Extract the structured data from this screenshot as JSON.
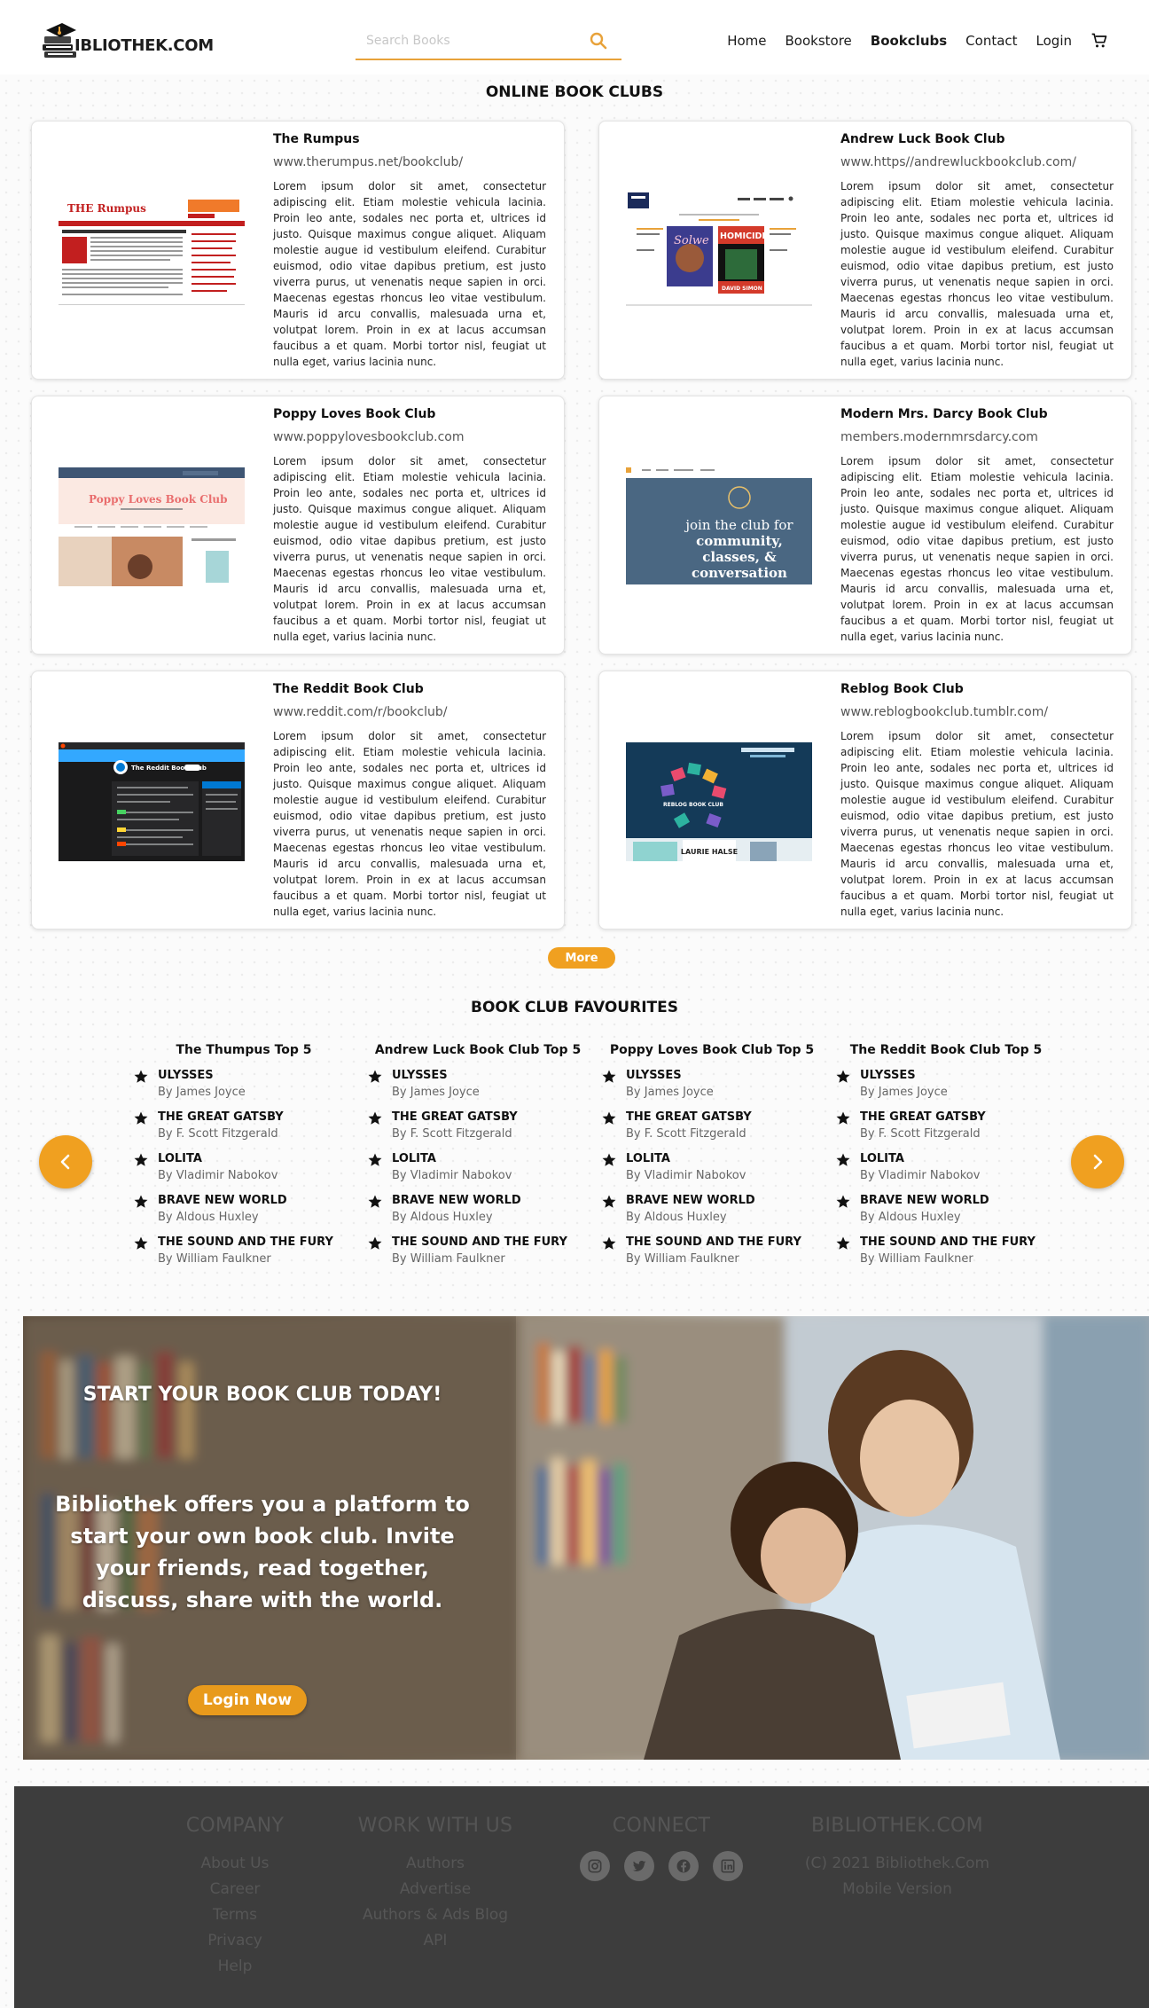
{
  "header": {
    "logo_text": "IBLIOTHEK.COM",
    "search_placeholder": "Search Books",
    "nav": [
      "Home",
      "Bookstore",
      "Bookclubs",
      "Contact",
      "Login"
    ],
    "active_nav": "Bookclubs"
  },
  "clubs": {
    "title": "ONLINE BOOK CLUBS",
    "description": "Lorem ipsum dolor sit amet, consectetur adipiscing elit. Etiam molestie vehicula lacinia. Proin leo ante, sodales nec porta et, ultrices id justo. Quisque maximus congue aliquet. Aliquam molestie augue id vestibulum eleifend. Curabitur euismod, odio vitae dapibus pretium, est justo viverra purus, ut venenatis neque sapien in orci. Maecenas egestas rhoncus leo vitae vestibulum. Mauris id arcu convallis, malesuada urna et, volutpat lorem. Proin in ex at lacus accumsan faucibus a et quam. Morbi tortor nisl, feugiat ut nulla eget, varius lacinia nunc.",
    "items": [
      {
        "name": "The Rumpus",
        "url": "www.therumpus.net/bookclub/"
      },
      {
        "name": "Andrew Luck Book Club",
        "url": "www.https//andrewluckbookclub.com/"
      },
      {
        "name": "Poppy Loves Book Club",
        "url": "www.poppylovesbookclub.com"
      },
      {
        "name": "Modern Mrs. Darcy Book Club",
        "url": "members.modernmrsdarcy.com"
      },
      {
        "name": "The Reddit Book Club",
        "url": "www.reddit.com/r/bookclub/"
      },
      {
        "name": "Reblog Book Club",
        "url": "www.reblogbookclub.tumblr.com/"
      }
    ],
    "thumb_texts": {
      "rumpus": "THE Rumpus",
      "poppy": "Poppy Loves Book Club",
      "darcy": "join the club for community, classes, & conversation",
      "reddit": "The Reddit Book Club",
      "andrew_book1": "Solwe",
      "andrew_book2": "HOMICIDE",
      "andrew_author": "DAVID SIMON",
      "reblog": "REBLOG BOOK CLUB",
      "reblog_author": "LAURIE HALSE"
    },
    "more_label": "More"
  },
  "favourites": {
    "title": "BOOK CLUB FAVOURITES",
    "columns": [
      {
        "title": "The Thumpus Top 5"
      },
      {
        "title": "Andrew Luck Book Club Top 5"
      },
      {
        "title": "Poppy Loves Book Club Top 5"
      },
      {
        "title": "The Reddit Book Club Top 5"
      }
    ],
    "books": [
      {
        "title": "ULYSSES",
        "author": "By James Joyce"
      },
      {
        "title": "THE GREAT GATSBY",
        "author": "By F. Scott Fitzgerald"
      },
      {
        "title": "LOLITA",
        "author": "By Vladimir Nabokov"
      },
      {
        "title": "BRAVE NEW WORLD",
        "author": "By Aldous Huxley"
      },
      {
        "title": "THE SOUND AND THE FURY",
        "author": "By William Faulkner"
      }
    ]
  },
  "hero": {
    "title": "START YOUR BOOK CLUB TODAY!",
    "text": "Bibliothek offers you a platform to start your own book club.  Invite your friends, read together, discuss, share with the world.",
    "button": "Login Now"
  },
  "footer": {
    "company": {
      "heading": "COMPANY",
      "links": [
        "About Us",
        "Career",
        "Terms",
        "Privacy",
        "Help"
      ]
    },
    "work": {
      "heading": "WORK WITH US",
      "links": [
        "Authors",
        "Advertise",
        "Authors & Ads Blog",
        "API"
      ]
    },
    "connect": {
      "heading": "CONNECT",
      "icons": [
        "instagram-icon",
        "twitter-icon",
        "facebook-icon",
        "linkedin-icon"
      ]
    },
    "brand": {
      "heading": "BIBLIOTHEK.COM",
      "lines": [
        "(C) 2021 Bibliothek.Com",
        "Mobile Version"
      ]
    }
  },
  "colors": {
    "accent": "#f0a020",
    "footer": "#3d3d3d"
  }
}
